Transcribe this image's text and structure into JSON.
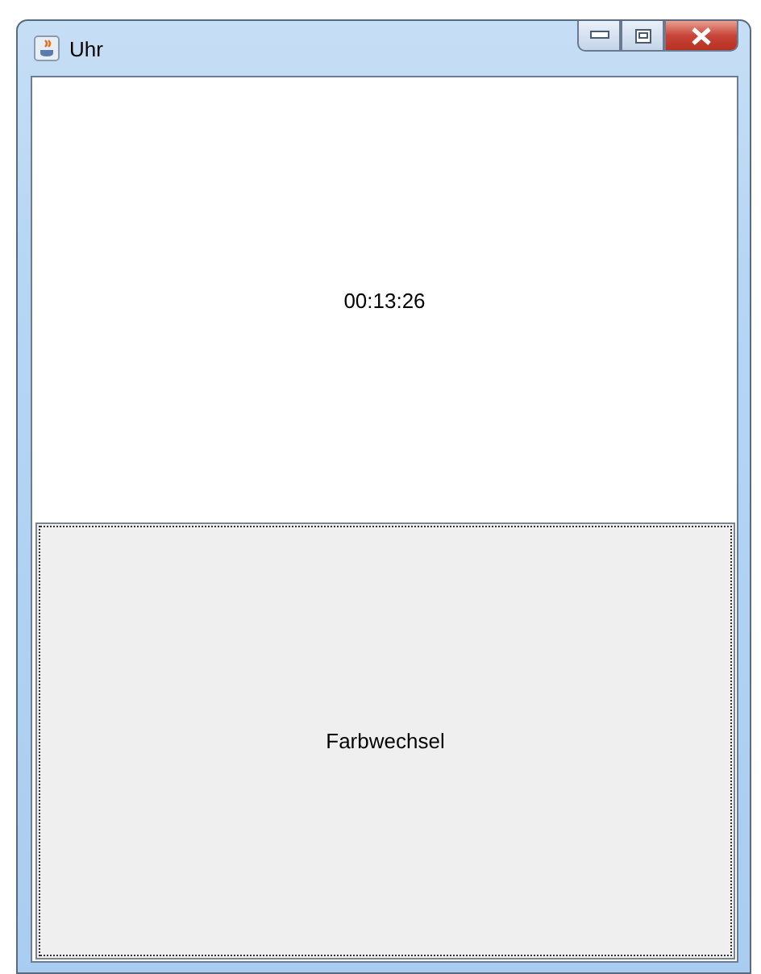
{
  "window": {
    "title": "Uhr"
  },
  "clock": {
    "time": "00:13:26"
  },
  "button": {
    "label": "Farbwechsel",
    "focused": true
  }
}
